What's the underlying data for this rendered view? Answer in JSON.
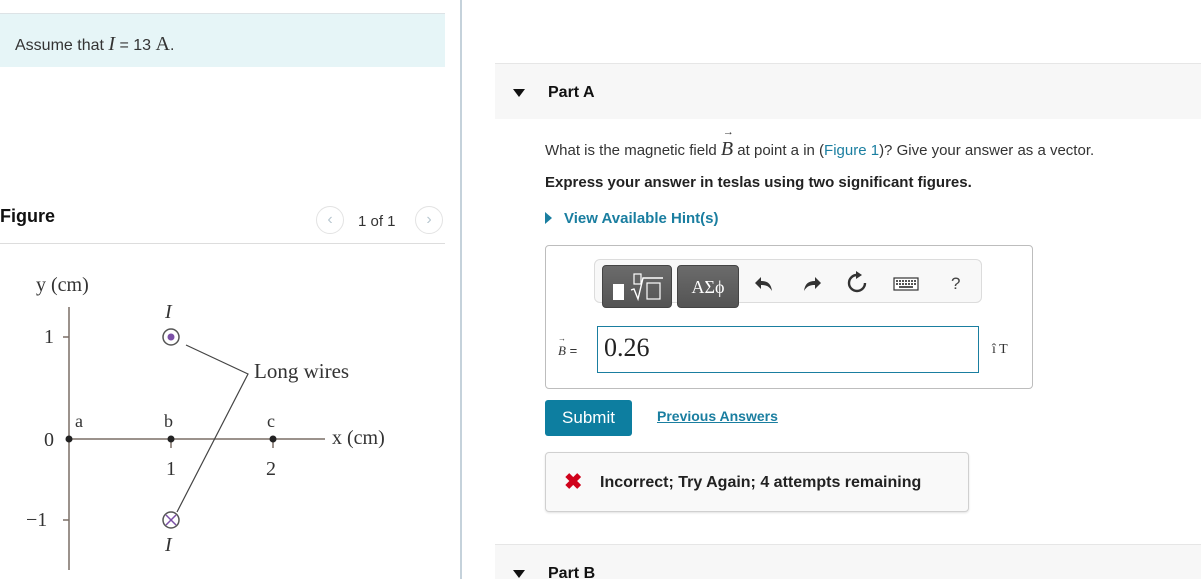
{
  "left": {
    "assume": {
      "prefix": "Assume that ",
      "var": "I",
      "equals": " = 13 ",
      "unit": "A",
      "suffix": "."
    },
    "figure": {
      "title": "Figure",
      "counter": "1 of 1",
      "prev_icon": "chevron-left",
      "next_icon": "chevron-right",
      "diagram": {
        "y_axis_label": "y (cm)",
        "x_axis_label": "x (cm)",
        "y_ticks": [
          "1",
          "0",
          "−1"
        ],
        "x_ticks": [
          "1",
          "2"
        ],
        "points": [
          "a",
          "b",
          "c"
        ],
        "wire_top_label": "I",
        "wire_bottom_label": "I",
        "callout": "Long wires",
        "wire_top_direction": "out-of-page",
        "wire_bottom_direction": "into-page",
        "wire_color": "#7b4fa6"
      }
    }
  },
  "right": {
    "part_a": {
      "label": "Part A",
      "question_pre": "What is the magnetic field ",
      "question_var": "B",
      "question_mid": " at point a in (",
      "question_link": "Figure 1",
      "question_post": ")? Give your answer as a vector.",
      "instruction": "Express your answer in teslas using two significant figures.",
      "hints_label": "View Available Hint(s)",
      "toolbar": {
        "template_icon": "templates-sqrt",
        "greek_label": "ΑΣϕ",
        "undo_icon": "undo",
        "redo_icon": "redo",
        "reset_icon": "reset",
        "keyboard_icon": "keyboard",
        "help_label": "?"
      },
      "input_label_var": "B",
      "input_label_eq": " =",
      "input_value": "0.26",
      "unit": "î T",
      "submit_label": "Submit",
      "previous_answers_label": "Previous Answers",
      "feedback_icon": "✖",
      "feedback_text": "Incorrect; Try Again; 4 attempts remaining"
    },
    "part_b": {
      "label": "Part B"
    }
  },
  "colors": {
    "accent": "#1a7ea0",
    "submit_bg": "#0d7ea0",
    "error": "#d0021b",
    "assume_bg": "#e6f5f7",
    "part_header_bg": "#f7f7f7"
  }
}
